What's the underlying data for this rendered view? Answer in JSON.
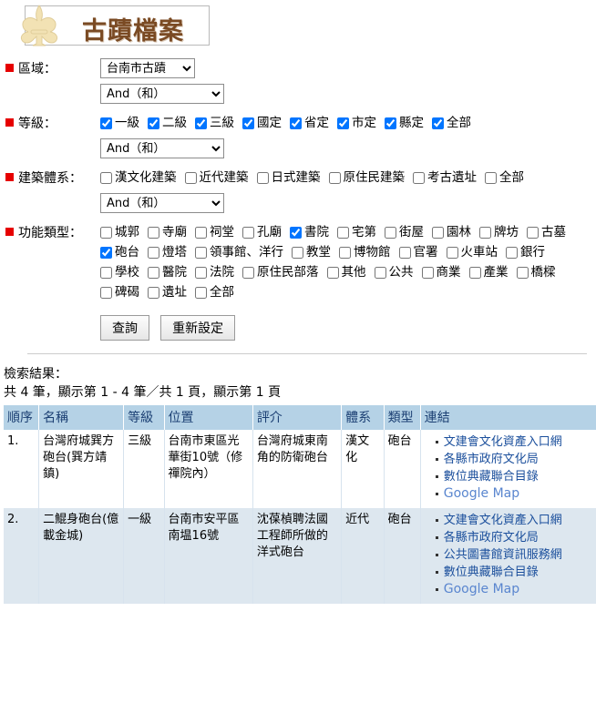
{
  "header": {
    "title": "古蹟檔案",
    "logo_icon": "fleur-de-lis-icon"
  },
  "form": {
    "region": {
      "label": "區域：",
      "selected": "台南市古蹟",
      "bool_selected": "And（和）"
    },
    "level": {
      "label": "等級：",
      "bool_selected": "And（和）",
      "options": [
        {
          "label": "一級",
          "checked": true
        },
        {
          "label": "二級",
          "checked": true
        },
        {
          "label": "三級",
          "checked": true
        },
        {
          "label": "國定",
          "checked": true
        },
        {
          "label": "省定",
          "checked": true
        },
        {
          "label": "市定",
          "checked": true
        },
        {
          "label": "縣定",
          "checked": true
        },
        {
          "label": "全部",
          "checked": true
        }
      ]
    },
    "system": {
      "label": "建築體系：",
      "bool_selected": "And（和）",
      "options": [
        {
          "label": "漢文化建築",
          "checked": false
        },
        {
          "label": "近代建築",
          "checked": false
        },
        {
          "label": "日式建築",
          "checked": false
        },
        {
          "label": "原住民建築",
          "checked": false
        },
        {
          "label": "考古遺址",
          "checked": false
        },
        {
          "label": "全部",
          "checked": false
        }
      ]
    },
    "function_type": {
      "label": "功能類型：",
      "options": [
        {
          "label": "城郭",
          "checked": false
        },
        {
          "label": "寺廟",
          "checked": false
        },
        {
          "label": "祠堂",
          "checked": false
        },
        {
          "label": "孔廟",
          "checked": false
        },
        {
          "label": "書院",
          "checked": true
        },
        {
          "label": "宅第",
          "checked": false
        },
        {
          "label": "街屋",
          "checked": false
        },
        {
          "label": "園林",
          "checked": false
        },
        {
          "label": "牌坊",
          "checked": false
        },
        {
          "label": "古墓",
          "checked": false
        },
        {
          "label": "砲台",
          "checked": true
        },
        {
          "label": "燈塔",
          "checked": false
        },
        {
          "label": "領事館、洋行",
          "checked": false
        },
        {
          "label": "教堂",
          "checked": false
        },
        {
          "label": "博物館",
          "checked": false
        },
        {
          "label": "官署",
          "checked": false
        },
        {
          "label": "火車站",
          "checked": false
        },
        {
          "label": "銀行",
          "checked": false
        },
        {
          "label": "學校",
          "checked": false
        },
        {
          "label": "醫院",
          "checked": false
        },
        {
          "label": "法院",
          "checked": false
        },
        {
          "label": "原住民部落",
          "checked": false
        },
        {
          "label": "其他",
          "checked": false
        },
        {
          "label": "公共",
          "checked": false
        },
        {
          "label": "商業",
          "checked": false
        },
        {
          "label": "產業",
          "checked": false
        },
        {
          "label": "橋樑",
          "checked": false
        },
        {
          "label": "碑碣",
          "checked": false
        },
        {
          "label": "遺址",
          "checked": false
        },
        {
          "label": "全部",
          "checked": false
        }
      ]
    },
    "buttons": {
      "search": "查詢",
      "reset": "重新設定"
    }
  },
  "results": {
    "heading": "檢索結果：",
    "summary": "共 4 筆，顯示第 1 - 4 筆／共 1 頁，顯示第 1 頁",
    "columns": [
      "順序",
      "名稱",
      "等級",
      "位置",
      "評介",
      "體系",
      "類型",
      "連結"
    ],
    "rows": [
      {
        "seq": "1.",
        "name": "台灣府城巽方砲台(巽方靖鎮)",
        "level": "三級",
        "location": "台南市東區光華街10號（修禪院內）",
        "description": "台灣府城東南角的防衛砲台",
        "system": "漢文化",
        "type": "砲台",
        "links": [
          "文建會文化資產入口網",
          "各縣市政府文化局",
          "數位典藏聯合目錄",
          "Google Map"
        ]
      },
      {
        "seq": "2.",
        "name": "二鯤身砲台(億載金城)",
        "level": "一級",
        "location": "台南市安平區南塭16號",
        "description": "沈葆楨聘法國工程師所做的洋式砲台",
        "system": "近代",
        "type": "砲台",
        "links": [
          "文建會文化資產入口網",
          "各縣市政府文化局",
          "公共圖書館資訊服務網",
          "數位典藏聯合目錄",
          "Google Map"
        ]
      }
    ]
  }
}
